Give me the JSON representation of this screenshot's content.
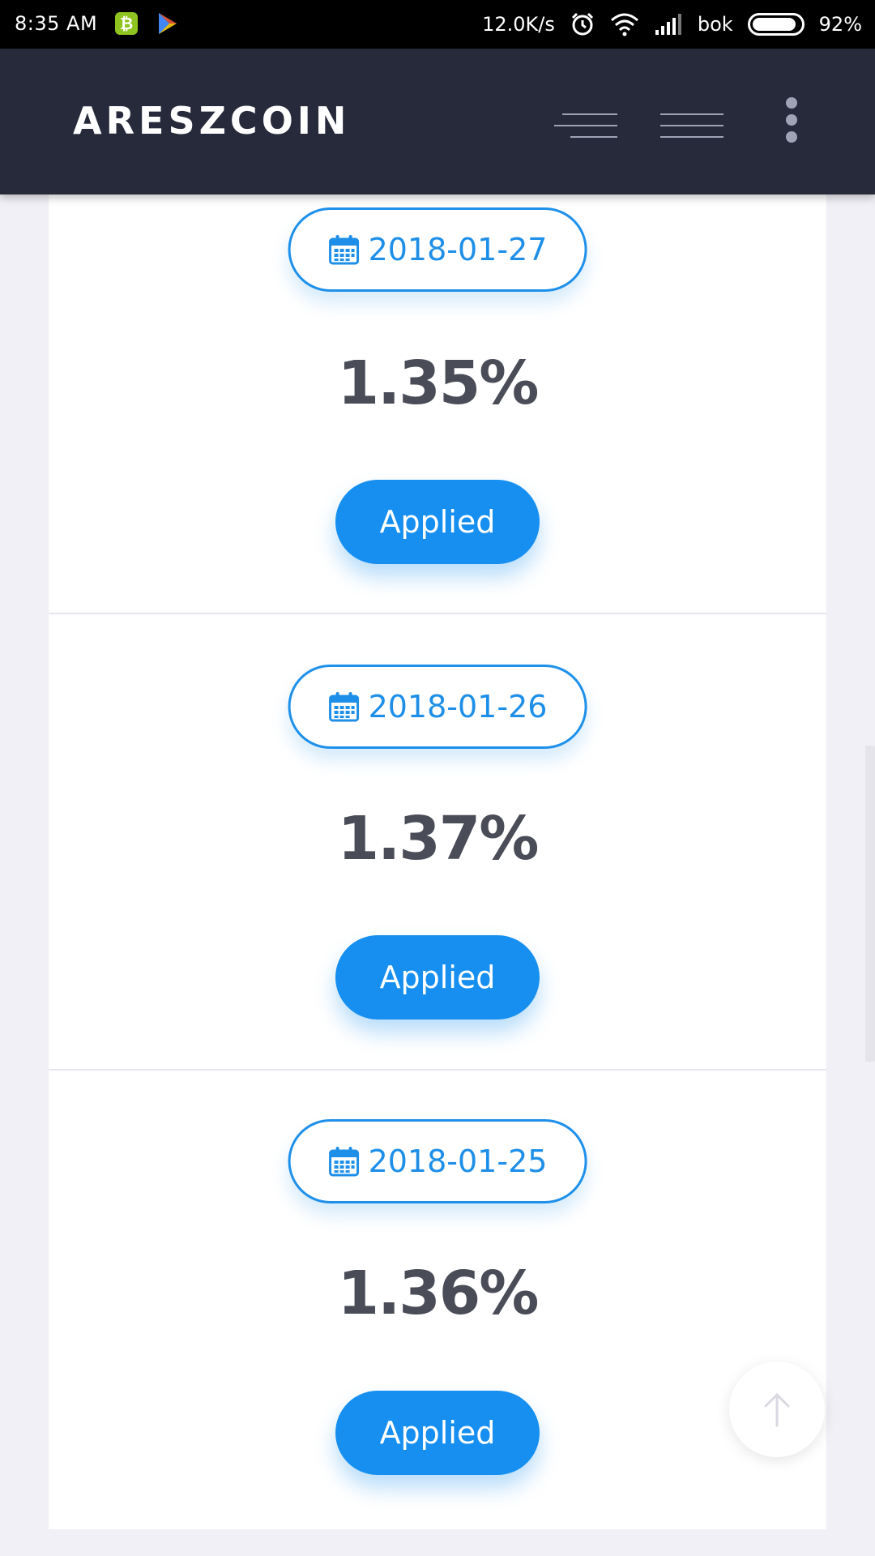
{
  "status_bar": {
    "time": "8:35 AM",
    "network_speed": "12.0K/s",
    "carrier": "bok",
    "battery": "92%",
    "battery_level": 0.92,
    "app_icons": [
      "bitcoin-icon",
      "play-store-icon"
    ],
    "system_icons": [
      "alarm-icon",
      "wifi-icon",
      "signal-icon",
      "battery-icon"
    ]
  },
  "header": {
    "logo": "ARESZCOIN",
    "icons": [
      "menu-lines-icon",
      "menu-lines-icon",
      "more-vertical-icon"
    ],
    "background": "#272a3a"
  },
  "entries": [
    {
      "date": "2018-01-27",
      "rate": "1.35%",
      "status": "Applied"
    },
    {
      "date": "2018-01-26",
      "rate": "1.37%",
      "status": "Applied"
    },
    {
      "date": "2018-01-25",
      "rate": "1.36%",
      "status": "Applied"
    }
  ],
  "colors": {
    "accent": "#168ff0",
    "rate_text": "#4a4c57",
    "page_bg": "#f0f0f6"
  },
  "back_to_top": {
    "icon": "arrow-up-icon"
  }
}
